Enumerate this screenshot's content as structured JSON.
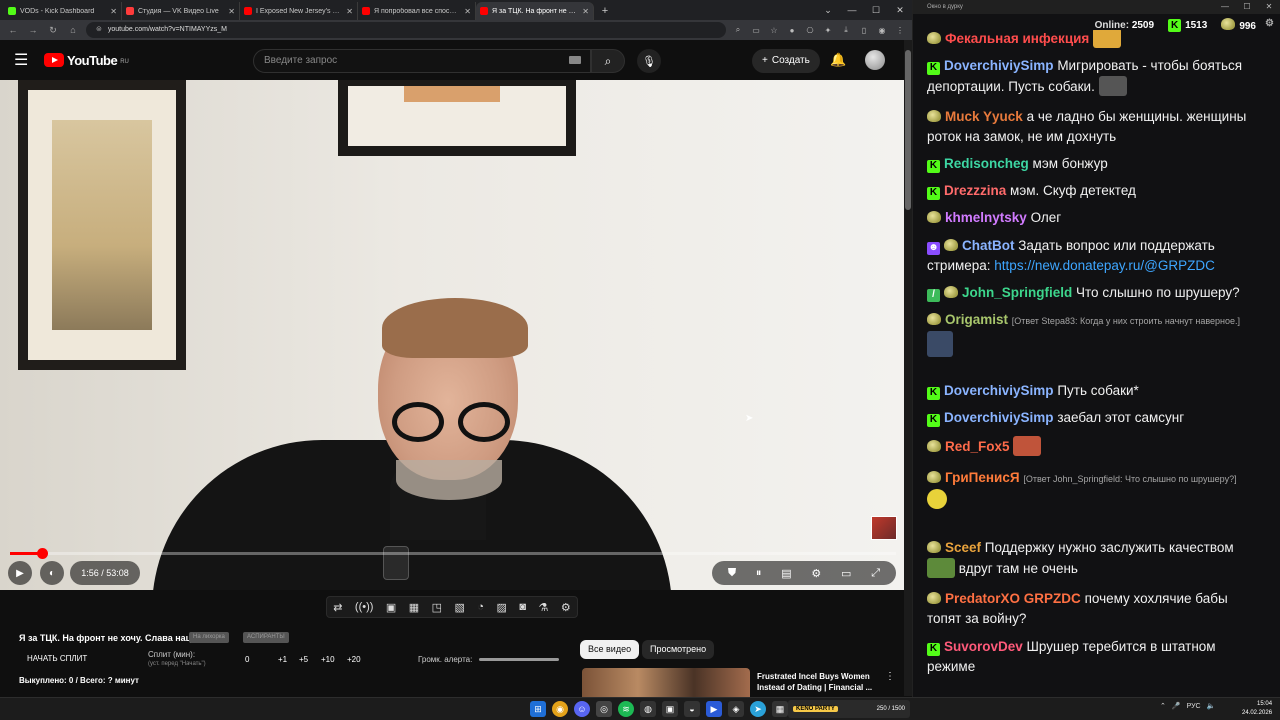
{
  "browser": {
    "tabs": [
      {
        "label": "VODs - Kick Dashboard",
        "color": "#53fc18",
        "active": false
      },
      {
        "label": "Студия — VK Видео Live",
        "color": "#ff3b3b",
        "active": false
      },
      {
        "label": "I Exposed New Jersey's Jewish",
        "color": "#ff0000",
        "active": false
      },
      {
        "label": "Я попробовал все способы бр",
        "color": "#ff0000",
        "active": false
      },
      {
        "label": "Я за ТЦК. На фронт не хоч",
        "color": "#ff0000",
        "active": true
      }
    ],
    "url": "youtube.com/watch?v=NTIMAYYzs_M"
  },
  "youtube": {
    "logo": "YouTube",
    "region": "RU",
    "search_placeholder": "Введите запрос",
    "create_label": "Создать"
  },
  "player": {
    "time": "1:56 / 53:08",
    "progress_fraction": 0.0364
  },
  "below_video": {
    "title": "Я за ТЦК. На фронт не хочу. Слава наці",
    "chip1": "На лихорка",
    "chip2": "АСПИРАНТЫ",
    "split_button": "НАЧАТЬ СПЛИТ",
    "split_label": "Сплит (мин):",
    "split_hint": "(уст. перед \"Начать\")",
    "split_values": [
      "0",
      "+1",
      "+5",
      "+10",
      "+20"
    ],
    "alert_label": "Громк. алерта:",
    "bought": "Выкуплено: 0 / Всего: ? минут",
    "filter_all": "Все видео",
    "filter_watched": "Просмотрено",
    "rec_title": "Frustrated Incel Buys Women Instead of Dating | Financial ..."
  },
  "chat": {
    "window_title": "Окно в дурку",
    "online_label": "Online:",
    "online_value": "2509",
    "kick_count": "1513",
    "vk_count": "996",
    "messages": [
      {
        "badge": "pepe",
        "nick": "Фекальная инфекция",
        "color": "#ff4d4d",
        "text": ""
      },
      {
        "badge": "kick",
        "nick": "DoverchiviySimp",
        "color": "#8ab4ff",
        "text": "Мигрировать - чтобы бояться депортации. Пусть собаки."
      },
      {
        "badge": "pepe",
        "nick": "Muck Yyuck",
        "color": "#e87a3c",
        "text": "а че ладно бы женщины. женщины роток на замок, не им дохнуть"
      },
      {
        "badge": "kick",
        "nick": "Redisoncheg",
        "color": "#3dd6a3",
        "text": "мэм бонжур"
      },
      {
        "badge": "kick",
        "nick": "Drezzzina",
        "color": "#ff6b6b",
        "text": "мэм. Скуф детектед"
      },
      {
        "badge": "pepe",
        "nick": "khmelnytsky",
        "color": "#d17bff",
        "text": "Олег"
      },
      {
        "badge": "bot",
        "nick": "ChatBot",
        "color": "#8ab4ff",
        "text": "Задать вопрос или поддержать стримера: ",
        "link": "https://new.donatepay.ru/@GRPZDC"
      },
      {
        "badge": "pen",
        "nick": "John_Springfield",
        "color": "#3dd68c",
        "text": "Что слышно по шрушеру?"
      },
      {
        "badge": "pepe",
        "nick": "Origamist",
        "color": "#a8c66c",
        "reply": "[Ответ Stepa83: Когда у них строить начнут наверное.]",
        "text": ""
      },
      {
        "badge": "kick",
        "nick": "DoverchiviySimp",
        "color": "#8ab4ff",
        "text": "Путь собаки*"
      },
      {
        "badge": "kick",
        "nick": "DoverchiviySimp",
        "color": "#8ab4ff",
        "text": "заебал этот самсунг"
      },
      {
        "badge": "pepe",
        "nick": "Red_Fox5",
        "color": "#ff6b4a",
        "text": ""
      },
      {
        "badge": "pepe",
        "nick": "ГриПенисЯ",
        "color": "#ff7b3a",
        "reply": "[Ответ John_Springfield: Что слышно по шрушеру?]",
        "text": ""
      },
      {
        "badge": "pepe",
        "nick": "Sceef",
        "color": "#e8a23c",
        "text": "Поддержку нужно заслужить качеством",
        "text2": " вдруг там не очень"
      },
      {
        "badge": "pepe",
        "nick": "PredatorXO",
        "color": "#ff7043",
        "nick2": "GRPZDC",
        "text": "почему хохлячие бабы топят за войну?"
      },
      {
        "badge": "kick",
        "nick": "SuvorovDev",
        "color": "#ff5a7a",
        "text": "Шрушер теребится в штатном режиме"
      }
    ]
  },
  "taskbar": {
    "widget_label": "KENO PARTY",
    "widget_counter": "250 / 1500",
    "lang": "РУС",
    "time": "15:04",
    "date": "24.02.2026"
  }
}
